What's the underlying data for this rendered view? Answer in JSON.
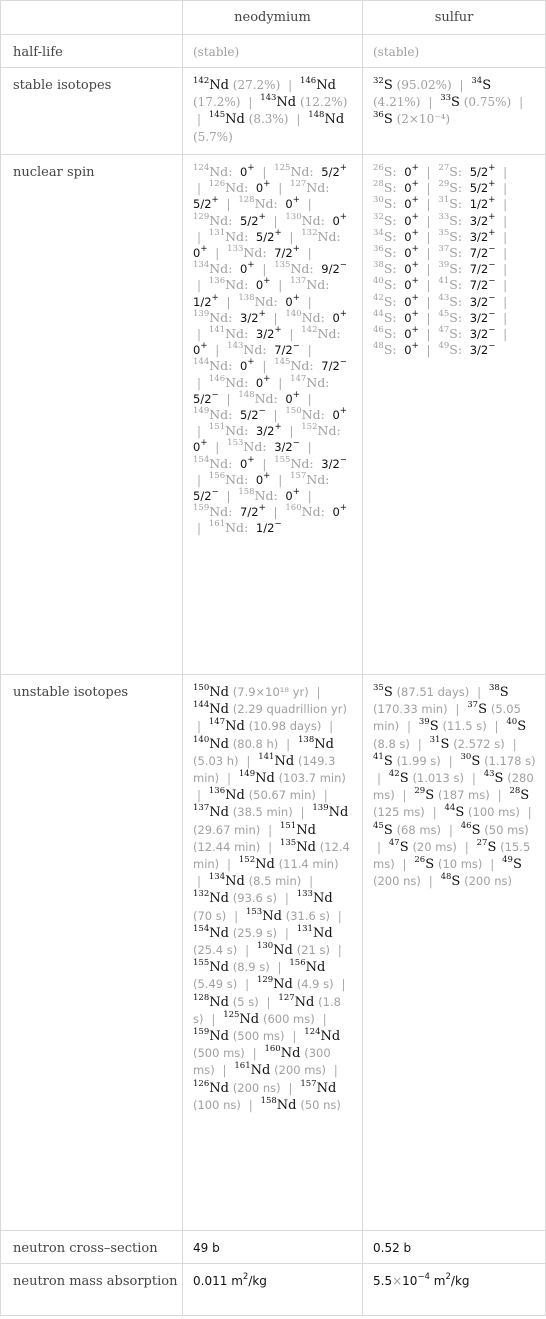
{
  "columns": [
    "",
    "neodymium",
    "sulfur"
  ],
  "rows": {
    "half_life": {
      "label": "half-life",
      "neodymium": "(stable)",
      "sulfur": "(stable)"
    },
    "stable_isotopes": {
      "label": "stable isotopes",
      "neodymium": [
        {
          "mass": "142",
          "symbol": "Nd",
          "abundance": "(27.2%)"
        },
        {
          "mass": "146",
          "symbol": "Nd",
          "abundance": "(17.2%)"
        },
        {
          "mass": "143",
          "symbol": "Nd",
          "abundance": "(12.2%)"
        },
        {
          "mass": "145",
          "symbol": "Nd",
          "abundance": "(8.3%)"
        },
        {
          "mass": "148",
          "symbol": "Nd",
          "abundance": "(5.7%)"
        }
      ],
      "sulfur": [
        {
          "mass": "32",
          "symbol": "S",
          "abundance": "(95.02%)"
        },
        {
          "mass": "34",
          "symbol": "S",
          "abundance": "(4.21%)"
        },
        {
          "mass": "33",
          "symbol": "S",
          "abundance": "(0.75%)"
        },
        {
          "mass": "36",
          "symbol": "S",
          "abundance": "(2×10⁻⁴)"
        }
      ]
    },
    "nuclear_spin": {
      "label": "nuclear spin",
      "neodymium": [
        {
          "mass": "124",
          "symbol": "Nd",
          "spin": "0",
          "parity": "+"
        },
        {
          "mass": "125",
          "symbol": "Nd",
          "spin": "5/2",
          "parity": "+"
        },
        {
          "mass": "126",
          "symbol": "Nd",
          "spin": "0",
          "parity": "+"
        },
        {
          "mass": "127",
          "symbol": "Nd",
          "spin": "5/2",
          "parity": "+"
        },
        {
          "mass": "128",
          "symbol": "Nd",
          "spin": "0",
          "parity": "+"
        },
        {
          "mass": "129",
          "symbol": "Nd",
          "spin": "5/2",
          "parity": "+"
        },
        {
          "mass": "130",
          "symbol": "Nd",
          "spin": "0",
          "parity": "+"
        },
        {
          "mass": "131",
          "symbol": "Nd",
          "spin": "5/2",
          "parity": "+"
        },
        {
          "mass": "132",
          "symbol": "Nd",
          "spin": "0",
          "parity": "+"
        },
        {
          "mass": "133",
          "symbol": "Nd",
          "spin": "7/2",
          "parity": "+"
        },
        {
          "mass": "134",
          "symbol": "Nd",
          "spin": "0",
          "parity": "+"
        },
        {
          "mass": "135",
          "symbol": "Nd",
          "spin": "9/2",
          "parity": "−"
        },
        {
          "mass": "136",
          "symbol": "Nd",
          "spin": "0",
          "parity": "+"
        },
        {
          "mass": "137",
          "symbol": "Nd",
          "spin": "1/2",
          "parity": "+"
        },
        {
          "mass": "138",
          "symbol": "Nd",
          "spin": "0",
          "parity": "+"
        },
        {
          "mass": "139",
          "symbol": "Nd",
          "spin": "3/2",
          "parity": "+"
        },
        {
          "mass": "140",
          "symbol": "Nd",
          "spin": "0",
          "parity": "+"
        },
        {
          "mass": "141",
          "symbol": "Nd",
          "spin": "3/2",
          "parity": "+"
        },
        {
          "mass": "142",
          "symbol": "Nd",
          "spin": "0",
          "parity": "+"
        },
        {
          "mass": "143",
          "symbol": "Nd",
          "spin": "7/2",
          "parity": "−"
        },
        {
          "mass": "144",
          "symbol": "Nd",
          "spin": "0",
          "parity": "+"
        },
        {
          "mass": "145",
          "symbol": "Nd",
          "spin": "7/2",
          "parity": "−"
        },
        {
          "mass": "146",
          "symbol": "Nd",
          "spin": "0",
          "parity": "+"
        },
        {
          "mass": "147",
          "symbol": "Nd",
          "spin": "5/2",
          "parity": "−"
        },
        {
          "mass": "148",
          "symbol": "Nd",
          "spin": "0",
          "parity": "+"
        },
        {
          "mass": "149",
          "symbol": "Nd",
          "spin": "5/2",
          "parity": "−"
        },
        {
          "mass": "150",
          "symbol": "Nd",
          "spin": "0",
          "parity": "+"
        },
        {
          "mass": "151",
          "symbol": "Nd",
          "spin": "3/2",
          "parity": "+"
        },
        {
          "mass": "152",
          "symbol": "Nd",
          "spin": "0",
          "parity": "+"
        },
        {
          "mass": "153",
          "symbol": "Nd",
          "spin": "3/2",
          "parity": "−"
        },
        {
          "mass": "154",
          "symbol": "Nd",
          "spin": "0",
          "parity": "+"
        },
        {
          "mass": "155",
          "symbol": "Nd",
          "spin": "3/2",
          "parity": "−"
        },
        {
          "mass": "156",
          "symbol": "Nd",
          "spin": "0",
          "parity": "+"
        },
        {
          "mass": "157",
          "symbol": "Nd",
          "spin": "5/2",
          "parity": "−"
        },
        {
          "mass": "158",
          "symbol": "Nd",
          "spin": "0",
          "parity": "+"
        },
        {
          "mass": "159",
          "symbol": "Nd",
          "spin": "7/2",
          "parity": "+"
        },
        {
          "mass": "160",
          "symbol": "Nd",
          "spin": "0",
          "parity": "+"
        },
        {
          "mass": "161",
          "symbol": "Nd",
          "spin": "1/2",
          "parity": "−"
        }
      ],
      "sulfur": [
        {
          "mass": "26",
          "symbol": "S",
          "spin": "0",
          "parity": "+"
        },
        {
          "mass": "27",
          "symbol": "S",
          "spin": "5/2",
          "parity": "+"
        },
        {
          "mass": "28",
          "symbol": "S",
          "spin": "0",
          "parity": "+"
        },
        {
          "mass": "29",
          "symbol": "S",
          "spin": "5/2",
          "parity": "+"
        },
        {
          "mass": "30",
          "symbol": "S",
          "spin": "0",
          "parity": "+"
        },
        {
          "mass": "31",
          "symbol": "S",
          "spin": "1/2",
          "parity": "+"
        },
        {
          "mass": "32",
          "symbol": "S",
          "spin": "0",
          "parity": "+"
        },
        {
          "mass": "33",
          "symbol": "S",
          "spin": "3/2",
          "parity": "+"
        },
        {
          "mass": "34",
          "symbol": "S",
          "spin": "0",
          "parity": "+"
        },
        {
          "mass": "35",
          "symbol": "S",
          "spin": "3/2",
          "parity": "+"
        },
        {
          "mass": "36",
          "symbol": "S",
          "spin": "0",
          "parity": "+"
        },
        {
          "mass": "37",
          "symbol": "S",
          "spin": "7/2",
          "parity": "−"
        },
        {
          "mass": "38",
          "symbol": "S",
          "spin": "0",
          "parity": "+"
        },
        {
          "mass": "39",
          "symbol": "S",
          "spin": "7/2",
          "parity": "−"
        },
        {
          "mass": "40",
          "symbol": "S",
          "spin": "0",
          "parity": "+"
        },
        {
          "mass": "41",
          "symbol": "S",
          "spin": "7/2",
          "parity": "−"
        },
        {
          "mass": "42",
          "symbol": "S",
          "spin": "0",
          "parity": "+"
        },
        {
          "mass": "43",
          "symbol": "S",
          "spin": "3/2",
          "parity": "−"
        },
        {
          "mass": "44",
          "symbol": "S",
          "spin": "0",
          "parity": "+"
        },
        {
          "mass": "45",
          "symbol": "S",
          "spin": "3/2",
          "parity": "−"
        },
        {
          "mass": "46",
          "symbol": "S",
          "spin": "0",
          "parity": "+"
        },
        {
          "mass": "47",
          "symbol": "S",
          "spin": "3/2",
          "parity": "−"
        },
        {
          "mass": "48",
          "symbol": "S",
          "spin": "0",
          "parity": "+"
        },
        {
          "mass": "49",
          "symbol": "S",
          "spin": "3/2",
          "parity": "−"
        }
      ]
    },
    "unstable_isotopes": {
      "label": "unstable isotopes",
      "neodymium": [
        {
          "mass": "150",
          "symbol": "Nd",
          "half_life": "(7.9×10¹⁸ yr)"
        },
        {
          "mass": "144",
          "symbol": "Nd",
          "half_life": "(2.29 quadrillion yr)"
        },
        {
          "mass": "147",
          "symbol": "Nd",
          "half_life": "(10.98 days)"
        },
        {
          "mass": "140",
          "symbol": "Nd",
          "half_life": "(80.8 h)"
        },
        {
          "mass": "138",
          "symbol": "Nd",
          "half_life": "(5.03 h)"
        },
        {
          "mass": "141",
          "symbol": "Nd",
          "half_life": "(149.3 min)"
        },
        {
          "mass": "149",
          "symbol": "Nd",
          "half_life": "(103.7 min)"
        },
        {
          "mass": "136",
          "symbol": "Nd",
          "half_life": "(50.67 min)"
        },
        {
          "mass": "137",
          "symbol": "Nd",
          "half_life": "(38.5 min)"
        },
        {
          "mass": "139",
          "symbol": "Nd",
          "half_life": "(29.67 min)"
        },
        {
          "mass": "151",
          "symbol": "Nd",
          "half_life": "(12.44 min)"
        },
        {
          "mass": "135",
          "symbol": "Nd",
          "half_life": "(12.4 min)"
        },
        {
          "mass": "152",
          "symbol": "Nd",
          "half_life": "(11.4 min)"
        },
        {
          "mass": "134",
          "symbol": "Nd",
          "half_life": "(8.5 min)"
        },
        {
          "mass": "132",
          "symbol": "Nd",
          "half_life": "(93.6 s)"
        },
        {
          "mass": "133",
          "symbol": "Nd",
          "half_life": "(70 s)"
        },
        {
          "mass": "153",
          "symbol": "Nd",
          "half_life": "(31.6 s)"
        },
        {
          "mass": "154",
          "symbol": "Nd",
          "half_life": "(25.9 s)"
        },
        {
          "mass": "131",
          "symbol": "Nd",
          "half_life": "(25.4 s)"
        },
        {
          "mass": "130",
          "symbol": "Nd",
          "half_life": "(21 s)"
        },
        {
          "mass": "155",
          "symbol": "Nd",
          "half_life": "(8.9 s)"
        },
        {
          "mass": "156",
          "symbol": "Nd",
          "half_life": "(5.49 s)"
        },
        {
          "mass": "129",
          "symbol": "Nd",
          "half_life": "(4.9 s)"
        },
        {
          "mass": "128",
          "symbol": "Nd",
          "half_life": "(5 s)"
        },
        {
          "mass": "127",
          "symbol": "Nd",
          "half_life": "(1.8 s)"
        },
        {
          "mass": "125",
          "symbol": "Nd",
          "half_life": "(600 ms)"
        },
        {
          "mass": "159",
          "symbol": "Nd",
          "half_life": "(500 ms)"
        },
        {
          "mass": "124",
          "symbol": "Nd",
          "half_life": "(500 ms)"
        },
        {
          "mass": "160",
          "symbol": "Nd",
          "half_life": "(300 ms)"
        },
        {
          "mass": "161",
          "symbol": "Nd",
          "half_life": "(200 ms)"
        },
        {
          "mass": "126",
          "symbol": "Nd",
          "half_life": "(200 ns)"
        },
        {
          "mass": "157",
          "symbol": "Nd",
          "half_life": "(100 ns)"
        },
        {
          "mass": "158",
          "symbol": "Nd",
          "half_life": "(50 ns)"
        }
      ],
      "sulfur": [
        {
          "mass": "35",
          "symbol": "S",
          "half_life": "(87.51 days)"
        },
        {
          "mass": "38",
          "symbol": "S",
          "half_life": "(170.33 min)"
        },
        {
          "mass": "37",
          "symbol": "S",
          "half_life": "(5.05 min)"
        },
        {
          "mass": "39",
          "symbol": "S",
          "half_life": "(11.5 s)"
        },
        {
          "mass": "40",
          "symbol": "S",
          "half_life": "(8.8 s)"
        },
        {
          "mass": "31",
          "symbol": "S",
          "half_life": "(2.572 s)"
        },
        {
          "mass": "41",
          "symbol": "S",
          "half_life": "(1.99 s)"
        },
        {
          "mass": "30",
          "symbol": "S",
          "half_life": "(1.178 s)"
        },
        {
          "mass": "42",
          "symbol": "S",
          "half_life": "(1.013 s)"
        },
        {
          "mass": "43",
          "symbol": "S",
          "half_life": "(280 ms)"
        },
        {
          "mass": "29",
          "symbol": "S",
          "half_life": "(187 ms)"
        },
        {
          "mass": "28",
          "symbol": "S",
          "half_life": "(125 ms)"
        },
        {
          "mass": "44",
          "symbol": "S",
          "half_life": "(100 ms)"
        },
        {
          "mass": "45",
          "symbol": "S",
          "half_life": "(68 ms)"
        },
        {
          "mass": "46",
          "symbol": "S",
          "half_life": "(50 ms)"
        },
        {
          "mass": "47",
          "symbol": "S",
          "half_life": "(20 ms)"
        },
        {
          "mass": "27",
          "symbol": "S",
          "half_life": "(15.5 ms)"
        },
        {
          "mass": "26",
          "symbol": "S",
          "half_life": "(10 ms)"
        },
        {
          "mass": "49",
          "symbol": "S",
          "half_life": "(200 ns)"
        },
        {
          "mass": "48",
          "symbol": "S",
          "half_life": "(200 ns)"
        }
      ]
    },
    "neutron_cross_section": {
      "label": "neutron cross–section",
      "neodymium": "49 b",
      "sulfur": "0.52 b"
    },
    "neutron_mass_absorption": {
      "label": "neutron mass absorption",
      "neodymium": {
        "mantissa": "0.011",
        "exponent": "",
        "unit": "m",
        "unit_exp": "2",
        "unit_tail": "/kg"
      },
      "sulfur": {
        "mantissa": "5.5",
        "times": "×",
        "base": "10",
        "exponent": "−4",
        "unit": "m",
        "unit_exp": "2",
        "unit_tail": "/kg"
      }
    }
  },
  "separator": "|"
}
